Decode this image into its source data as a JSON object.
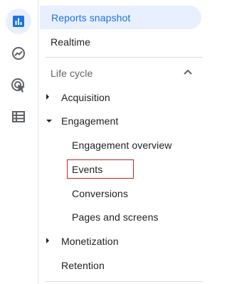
{
  "rail": {
    "icons": [
      {
        "name": "reports-icon",
        "active": true
      },
      {
        "name": "explore-icon",
        "active": false
      },
      {
        "name": "advertising-icon",
        "active": false
      },
      {
        "name": "configure-icon",
        "active": false
      }
    ]
  },
  "nav": {
    "reports_snapshot": "Reports snapshot",
    "realtime": "Realtime",
    "life_cycle": "Life cycle",
    "acquisition": "Acquisition",
    "engagement": "Engagement",
    "engagement_children": {
      "overview": "Engagement overview",
      "events": "Events",
      "conversions": "Conversions",
      "pages_and_screens": "Pages and screens"
    },
    "monetization": "Monetization",
    "retention": "Retention"
  },
  "colors": {
    "accent": "#1a73e8",
    "selected_bg": "#e8f0fe",
    "highlight_border": "#c5221f"
  }
}
